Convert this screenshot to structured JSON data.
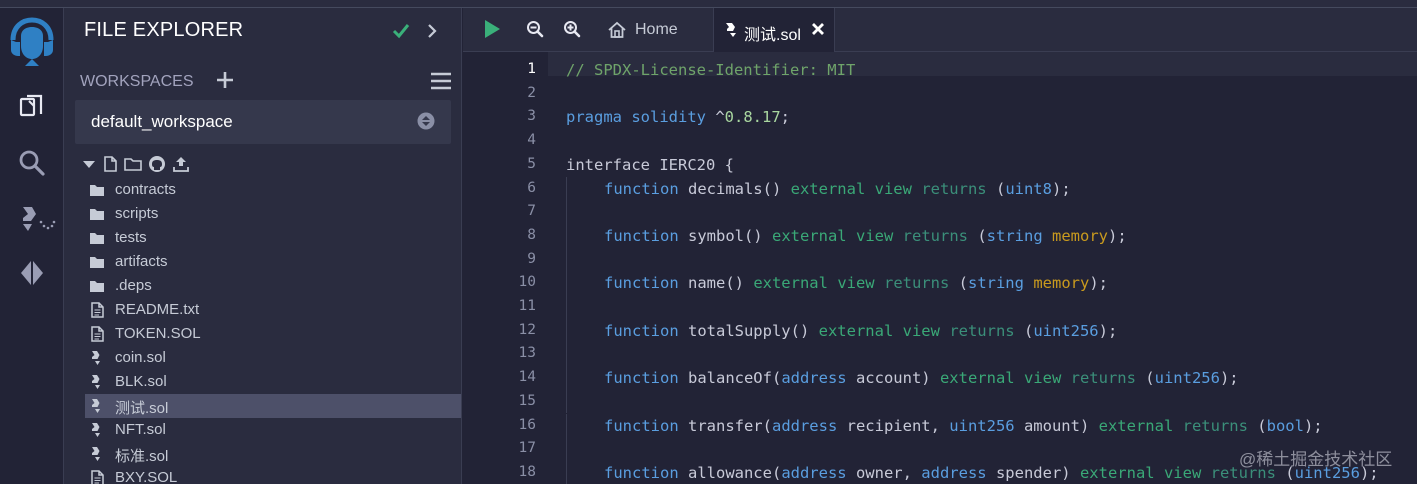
{
  "panel": {
    "title": "FILE EXPLORER",
    "workspaces_label": "WORKSPACES",
    "workspace_value": "default_workspace"
  },
  "files": [
    {
      "label": "contracts",
      "kind": "folder"
    },
    {
      "label": "scripts",
      "kind": "folder"
    },
    {
      "label": "tests",
      "kind": "folder"
    },
    {
      "label": "artifacts",
      "kind": "folder"
    },
    {
      "label": ".deps",
      "kind": "folder"
    },
    {
      "label": "README.txt",
      "kind": "file"
    },
    {
      "label": "TOKEN.SOL",
      "kind": "file"
    },
    {
      "label": "coin.sol",
      "kind": "sol"
    },
    {
      "label": "BLK.sol",
      "kind": "sol"
    },
    {
      "label": "测试.sol",
      "kind": "sol",
      "active": true
    },
    {
      "label": "NFT.sol",
      "kind": "sol"
    },
    {
      "label": "标准.sol",
      "kind": "sol"
    },
    {
      "label": "BXY.SOL",
      "kind": "file"
    }
  ],
  "tabs": {
    "home_label": "Home",
    "active_label": "测试.sol"
  },
  "editor": {
    "current_line": 1,
    "lines": [
      {
        "n": "1",
        "indent": 0,
        "parts": [
          [
            "com",
            "// SPDX-License-Identifier: MIT"
          ]
        ]
      },
      {
        "n": "2",
        "indent": 0,
        "parts": []
      },
      {
        "n": "3",
        "indent": 0,
        "parts": [
          [
            "blue",
            "pragma"
          ],
          [
            "fn",
            " "
          ],
          [
            "blue",
            "solidity"
          ],
          [
            "fn",
            " ^"
          ],
          [
            "num",
            "0.8.17"
          ],
          [
            "fn",
            ";"
          ]
        ]
      },
      {
        "n": "4",
        "indent": 0,
        "parts": []
      },
      {
        "n": "5",
        "indent": 0,
        "parts": [
          [
            "fn",
            "interface IERC20 {"
          ]
        ]
      },
      {
        "n": "6",
        "indent": 1,
        "parts": [
          [
            "blue",
            "function"
          ],
          [
            "fn",
            " decimals() "
          ],
          [
            "green",
            "external"
          ],
          [
            "fn",
            " "
          ],
          [
            "green",
            "view"
          ],
          [
            "fn",
            " "
          ],
          [
            "teal",
            "returns"
          ],
          [
            "fn",
            " ("
          ],
          [
            "blue",
            "uint8"
          ],
          [
            "fn",
            ");"
          ]
        ]
      },
      {
        "n": "7",
        "indent": 0,
        "parts": []
      },
      {
        "n": "8",
        "indent": 1,
        "parts": [
          [
            "blue",
            "function"
          ],
          [
            "fn",
            " symbol() "
          ],
          [
            "green",
            "external"
          ],
          [
            "fn",
            " "
          ],
          [
            "green",
            "view"
          ],
          [
            "fn",
            " "
          ],
          [
            "teal",
            "returns"
          ],
          [
            "fn",
            " ("
          ],
          [
            "blue",
            "string"
          ],
          [
            "fn",
            " "
          ],
          [
            "gold",
            "memory"
          ],
          [
            "fn",
            ");"
          ]
        ]
      },
      {
        "n": "9",
        "indent": 0,
        "parts": []
      },
      {
        "n": "10",
        "indent": 1,
        "parts": [
          [
            "blue",
            "function"
          ],
          [
            "fn",
            " name() "
          ],
          [
            "green",
            "external"
          ],
          [
            "fn",
            " "
          ],
          [
            "green",
            "view"
          ],
          [
            "fn",
            " "
          ],
          [
            "teal",
            "returns"
          ],
          [
            "fn",
            " ("
          ],
          [
            "blue",
            "string"
          ],
          [
            "fn",
            " "
          ],
          [
            "gold",
            "memory"
          ],
          [
            "fn",
            ");"
          ]
        ]
      },
      {
        "n": "11",
        "indent": 0,
        "parts": []
      },
      {
        "n": "12",
        "indent": 1,
        "parts": [
          [
            "blue",
            "function"
          ],
          [
            "fn",
            " totalSupply() "
          ],
          [
            "green",
            "external"
          ],
          [
            "fn",
            " "
          ],
          [
            "green",
            "view"
          ],
          [
            "fn",
            " "
          ],
          [
            "teal",
            "returns"
          ],
          [
            "fn",
            " ("
          ],
          [
            "blue",
            "uint256"
          ],
          [
            "fn",
            ");"
          ]
        ]
      },
      {
        "n": "13",
        "indent": 0,
        "parts": []
      },
      {
        "n": "14",
        "indent": 1,
        "parts": [
          [
            "blue",
            "function"
          ],
          [
            "fn",
            " balanceOf("
          ],
          [
            "blue",
            "address"
          ],
          [
            "fn",
            " account) "
          ],
          [
            "green",
            "external"
          ],
          [
            "fn",
            " "
          ],
          [
            "green",
            "view"
          ],
          [
            "fn",
            " "
          ],
          [
            "teal",
            "returns"
          ],
          [
            "fn",
            " ("
          ],
          [
            "blue",
            "uint256"
          ],
          [
            "fn",
            ");"
          ]
        ]
      },
      {
        "n": "15",
        "indent": 0,
        "parts": []
      },
      {
        "n": "16",
        "indent": 1,
        "parts": [
          [
            "blue",
            "function"
          ],
          [
            "fn",
            " transfer("
          ],
          [
            "blue",
            "address"
          ],
          [
            "fn",
            " recipient, "
          ],
          [
            "blue",
            "uint256"
          ],
          [
            "fn",
            " amount) "
          ],
          [
            "green",
            "external"
          ],
          [
            "fn",
            " "
          ],
          [
            "teal",
            "returns"
          ],
          [
            "fn",
            " ("
          ],
          [
            "blue",
            "bool"
          ],
          [
            "fn",
            ");"
          ]
        ]
      },
      {
        "n": "17",
        "indent": 0,
        "parts": []
      },
      {
        "n": "18",
        "indent": 1,
        "parts": [
          [
            "blue",
            "function"
          ],
          [
            "fn",
            " allowance("
          ],
          [
            "blue",
            "address"
          ],
          [
            "fn",
            " owner, "
          ],
          [
            "blue",
            "address"
          ],
          [
            "fn",
            " spender) "
          ],
          [
            "green",
            "external"
          ],
          [
            "fn",
            " "
          ],
          [
            "green",
            "view"
          ],
          [
            "fn",
            " "
          ],
          [
            "teal",
            "returns"
          ],
          [
            "fn",
            " ("
          ],
          [
            "blue",
            "uint256"
          ],
          [
            "fn",
            ");"
          ]
        ]
      }
    ]
  },
  "watermark": "@稀土掘金技术社区",
  "colors": {
    "accent_green": "#3ab07a",
    "keyword_blue": "#5a9ee0",
    "memory_gold": "#c99a1e",
    "comment_green": "#6fa46a"
  }
}
